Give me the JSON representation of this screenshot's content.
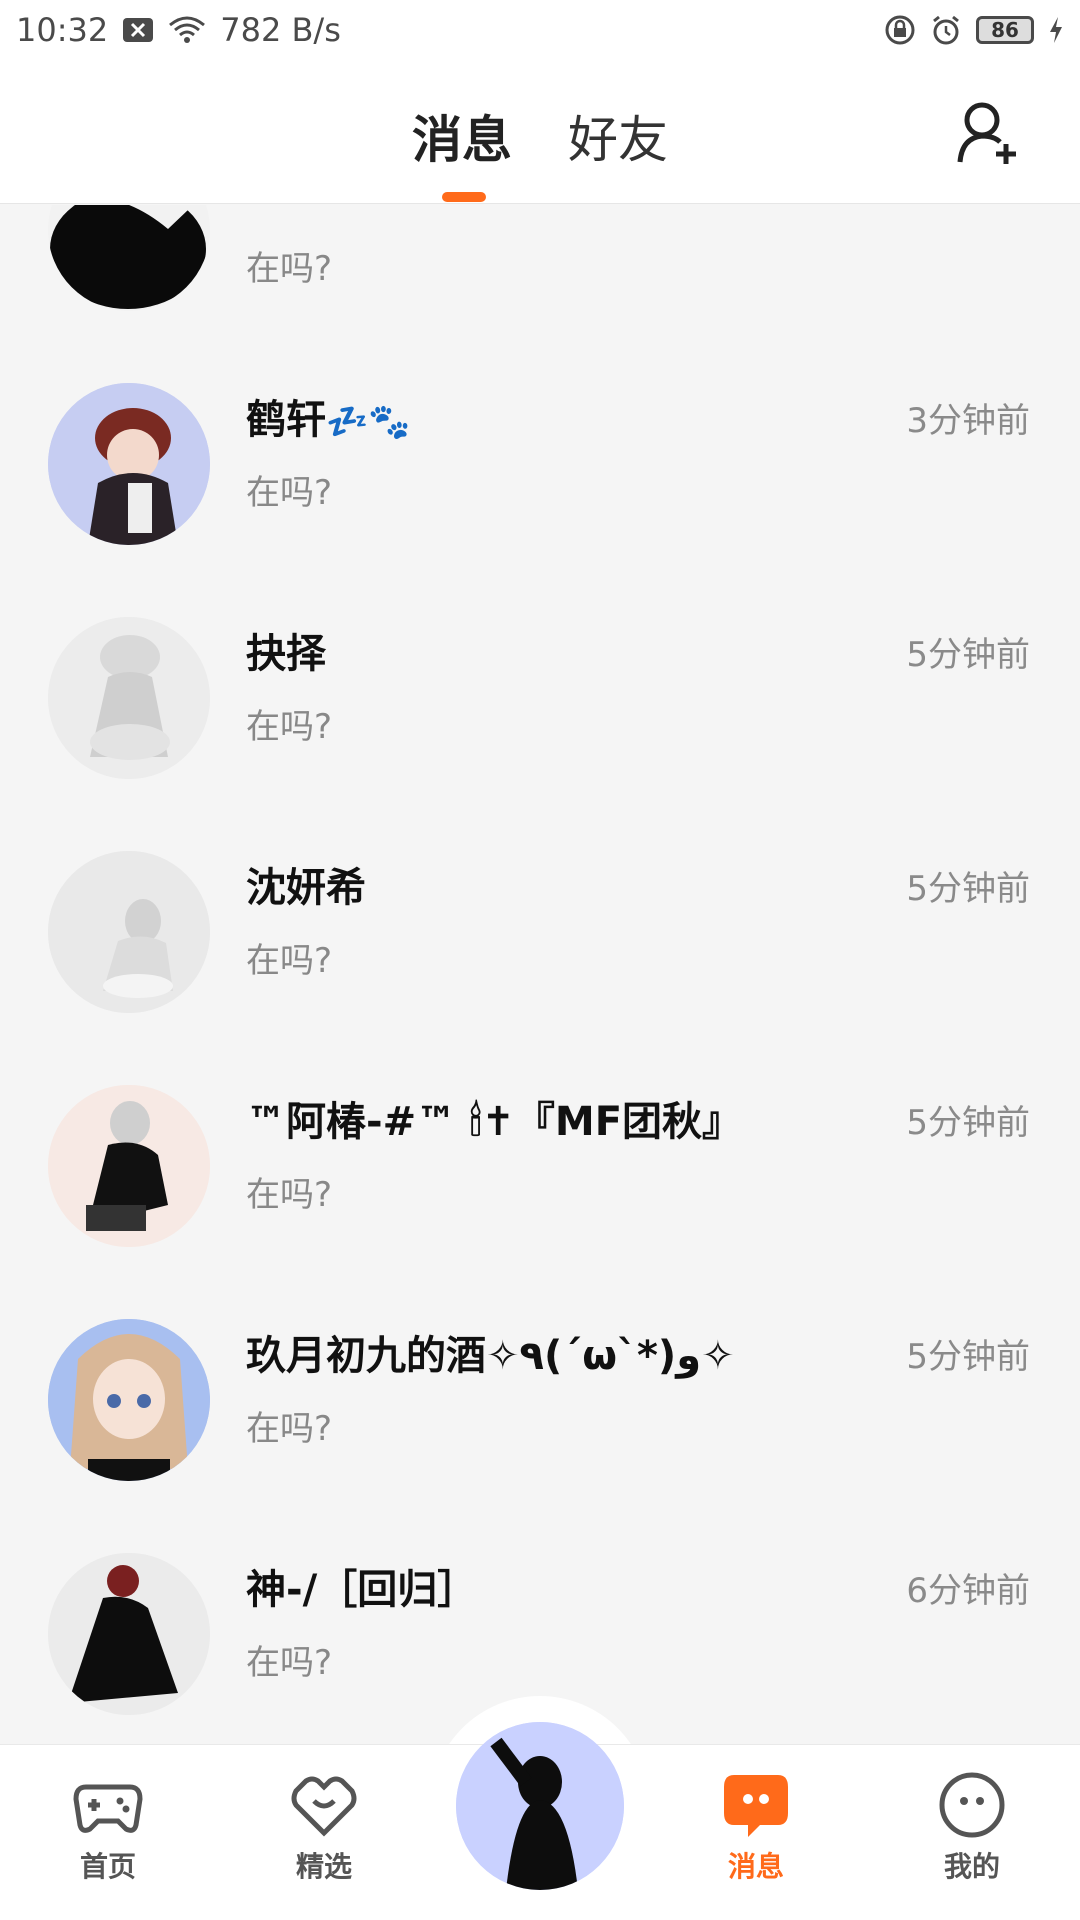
{
  "status_bar": {
    "time": "10:32",
    "net_speed": "782 B/s",
    "battery": "86",
    "icons": [
      "close-box-icon",
      "wifi-icon",
      "lock-icon",
      "alarm-icon",
      "battery-icon",
      "charging-icon"
    ]
  },
  "header": {
    "tabs": [
      {
        "label": "消息",
        "active": true
      },
      {
        "label": "好友",
        "active": false
      }
    ],
    "add_friend_icon": "add-user-icon",
    "accent": "#ff6a1a"
  },
  "conversations": [
    {
      "name": "",
      "message": "在吗?",
      "time": ""
    },
    {
      "name": "鹤轩",
      "emoji": "💤🐾",
      "message": "在吗?",
      "time": "3分钟前"
    },
    {
      "name": "抉择",
      "message": "在吗?",
      "time": "5分钟前"
    },
    {
      "name": "沈妍希",
      "message": "在吗?",
      "time": "5分钟前"
    },
    {
      "name": "™阿椿-#™ 🕯✝『MF团秋』",
      "message": "在吗?",
      "time": "5分钟前"
    },
    {
      "name": "玖月初九的酒✧٩(ˊωˋ*)و✧",
      "message": "在吗?",
      "time": "5分钟前"
    },
    {
      "name": "神-/［回归］",
      "message": "在吗?",
      "time": "6分钟前"
    }
  ],
  "bottom_nav": [
    {
      "label": "首页",
      "icon": "gamepad-icon",
      "active": false
    },
    {
      "label": "精选",
      "icon": "heart-chat-icon",
      "active": false
    },
    {
      "label": "",
      "icon": "center-avatar",
      "active": false
    },
    {
      "label": "消息",
      "icon": "message-bubble-icon",
      "active": true
    },
    {
      "label": "我的",
      "icon": "face-icon",
      "active": false
    }
  ]
}
